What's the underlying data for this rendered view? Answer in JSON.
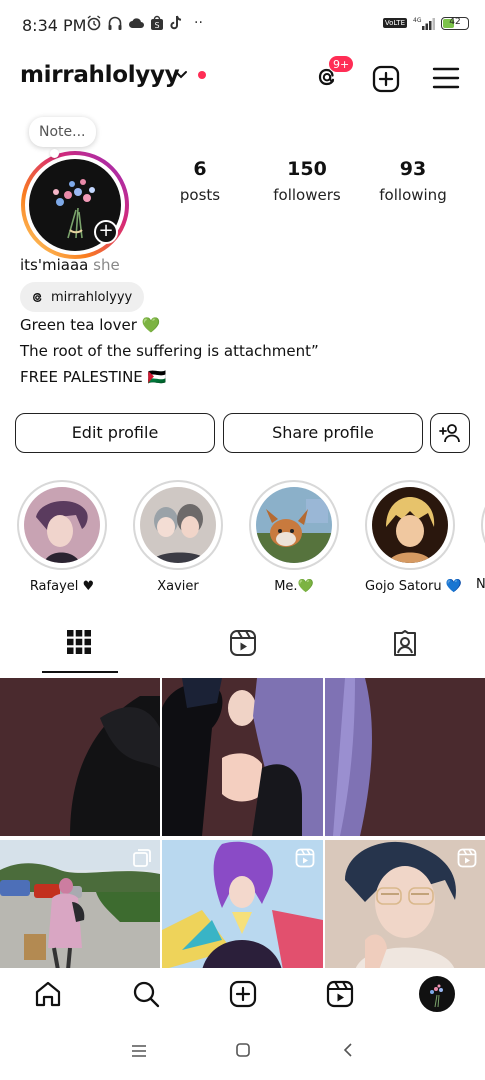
{
  "status_bar": {
    "time": "8:34 PM",
    "network": "4G",
    "volte": "VoLTE",
    "battery": "42"
  },
  "header": {
    "username": "mirrahlolyyy",
    "notification_badge": "9+"
  },
  "profile": {
    "note": "Note...",
    "stats": [
      {
        "value": "6",
        "label": "posts"
      },
      {
        "value": "150",
        "label": "followers"
      },
      {
        "value": "93",
        "label": "following"
      }
    ],
    "display_name": "its'miaaa",
    "pronouns": "she",
    "threads_handle": "mirrahlolyyy",
    "bio_lines": [
      "Green tea lover 💚",
      "The root of the suffering is attachment”",
      "FREE PALESTINE 🇵🇸"
    ]
  },
  "buttons": {
    "edit": "Edit profile",
    "share": "Share profile"
  },
  "highlights": [
    {
      "label": "Rafayel ♥"
    },
    {
      "label": "Xavier"
    },
    {
      "label": "Me.💚"
    },
    {
      "label": "Gojo Satoru 💙"
    },
    {
      "label": "N"
    }
  ],
  "tabs": [
    "grid-icon",
    "reels-icon",
    "tagged-icon"
  ],
  "colors": {
    "accent_red": "#ff2d55",
    "story_ring_gradient": [
      "#feda75",
      "#fa7e1e",
      "#d62976",
      "#962fbf"
    ]
  }
}
